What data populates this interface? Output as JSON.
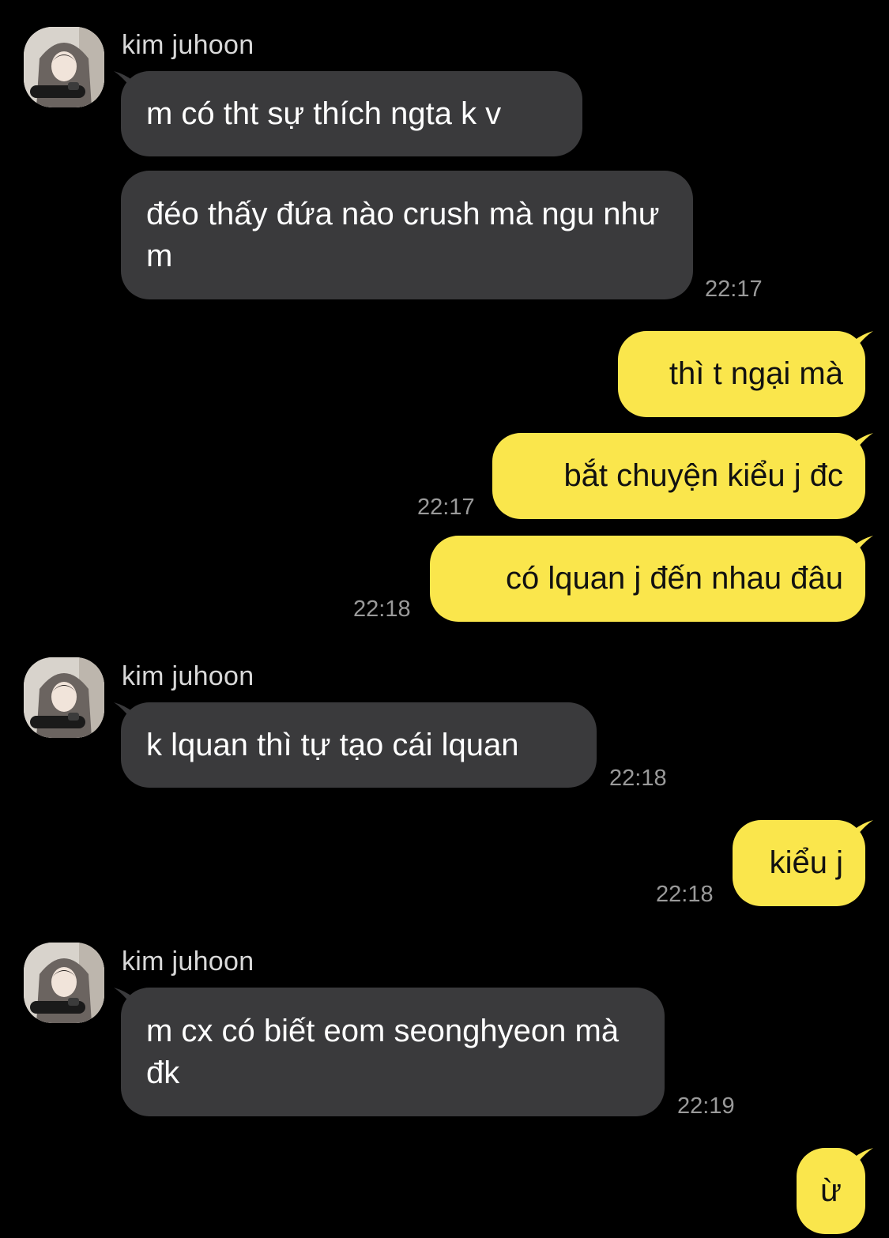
{
  "chat": {
    "contact_name": "kim juhoon",
    "colors": {
      "background": "#000000",
      "incoming_bubble": "#3a3a3c",
      "outgoing_bubble": "#fae64c",
      "timestamp": "#9a9a9a"
    },
    "messages": [
      {
        "dir": "in",
        "sender": "kim juhoon",
        "text": "m có tht sự thích ngta k v"
      },
      {
        "dir": "in",
        "text": "đéo thấy đứa nào crush mà ngu như m",
        "time": "22:17"
      },
      {
        "dir": "out",
        "text": "thì t ngại mà"
      },
      {
        "dir": "out",
        "text": "bắt chuyện kiểu j đc",
        "time": "22:17"
      },
      {
        "dir": "out",
        "text": "có lquan j đến nhau đâu",
        "time": "22:18"
      },
      {
        "dir": "in",
        "sender": "kim juhoon",
        "text": "k lquan thì tự tạo cái lquan",
        "time": "22:18"
      },
      {
        "dir": "out",
        "text": "kiểu j",
        "time": "22:18"
      },
      {
        "dir": "in",
        "sender": "kim juhoon",
        "text": "m cx có biết eom seonghyeon mà đk",
        "time": "22:19"
      },
      {
        "dir": "out",
        "text": "ừ"
      }
    ]
  }
}
